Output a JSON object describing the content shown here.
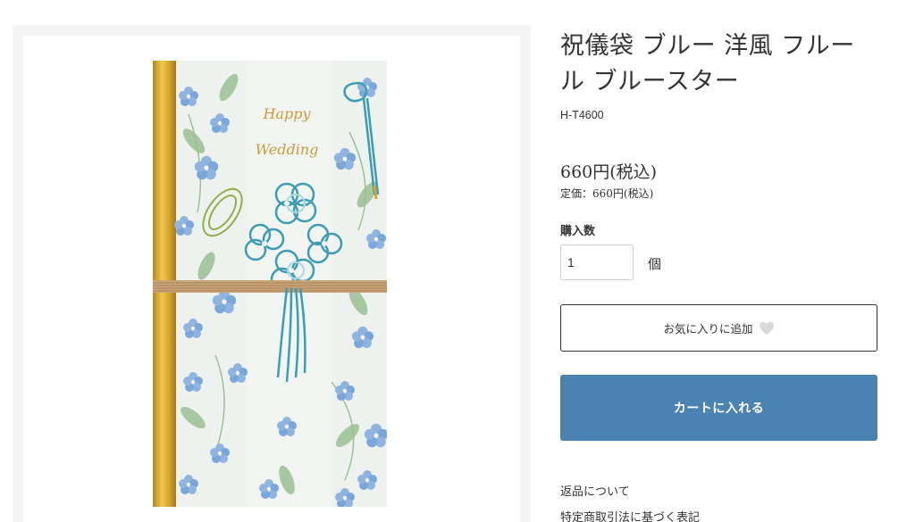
{
  "product": {
    "image_alt": "祝儀袋 ブルー 洋風 フルール ブルースター",
    "title": "祝儀袋 ブルー 洋風 フルール ブルースター",
    "sku": "H-T4600",
    "price": "660円(税込)",
    "list_price": "定価：660円(税込)",
    "envelope_text": [
      "Happy",
      "Wedding"
    ]
  },
  "purchase": {
    "qty_label": "購入数",
    "qty_value": "1",
    "qty_unit": "個",
    "favorite_label": "お気に入りに追加",
    "cart_label": "カートに入れる"
  },
  "links": {
    "returns": "返品について",
    "tokusho": "特定商取引法に基づく表記"
  },
  "colors": {
    "cart_button": "#4a82b2",
    "heart": "#d9d9d9",
    "gold": "#d4a72c",
    "flower_blue": "#6f9fd4",
    "mizuhiki": "#3c9cb4"
  }
}
